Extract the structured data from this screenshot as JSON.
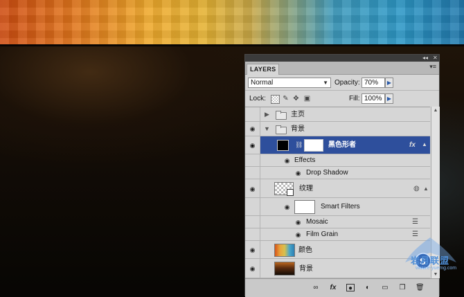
{
  "panel": {
    "tab_label": "LAYERS",
    "blend_mode": "Normal",
    "opacity_label": "Opacity:",
    "opacity_value": "70%",
    "lock_label": "Lock:",
    "fill_label": "Fill:",
    "fill_value": "100%"
  },
  "layers": [
    {
      "name": "主页",
      "type": "group",
      "visible": false,
      "expanded": false
    },
    {
      "name": "背景",
      "type": "group",
      "visible": true,
      "expanded": true
    },
    {
      "name": "黑色形者",
      "type": "shape",
      "visible": true,
      "selected": true,
      "has_fx": true
    },
    {
      "name": "Effects",
      "type": "effects-header",
      "visible": true
    },
    {
      "name": "Drop Shadow",
      "type": "effect",
      "visible": true
    },
    {
      "name": "纹理",
      "type": "smart-object",
      "visible": true
    },
    {
      "name": "Smart Filters",
      "type": "smart-filters",
      "visible": true
    },
    {
      "name": "Mosaic",
      "type": "filter",
      "visible": true
    },
    {
      "name": "Film Grain",
      "type": "filter",
      "visible": true
    },
    {
      "name": "颜色",
      "type": "layer",
      "visible": true
    },
    {
      "name": "背景",
      "type": "layer",
      "visible": true
    }
  ],
  "footer_icons": [
    "link-icon",
    "fx-icon",
    "mask-icon",
    "adjustment-icon",
    "new-group-icon",
    "new-layer-icon",
    "trash-icon"
  ],
  "watermark": {
    "text": "岩月联盟",
    "url": "www.e-yuemg.com"
  },
  "colors": {
    "selection": "#2e4f9c",
    "panel_bg": "#d6d6d6"
  }
}
